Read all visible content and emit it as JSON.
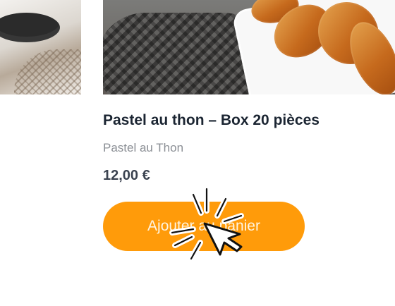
{
  "product": {
    "title": "Pastel au thon – Box 20 pièces",
    "subtitle": "Pastel au Thon",
    "price": "12,00 €",
    "button_label": "Ajouter au panier"
  },
  "icons": {
    "cursor": "mouse-pointer-icon",
    "click": "click-burst-icon"
  },
  "colors": {
    "button": "#ff9b0a",
    "title": "#1b2532",
    "subtitle": "#8b8f95",
    "price": "#3b4350"
  }
}
